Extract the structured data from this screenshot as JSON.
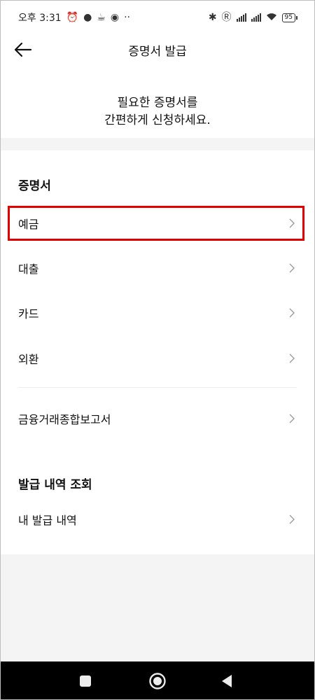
{
  "status_bar": {
    "time": "오후 3:31",
    "battery": "95",
    "icons": [
      "alarm-icon",
      "chat-icon",
      "coffee-icon",
      "chrome-icon",
      "more-dots-icon",
      "bluetooth-icon",
      "roaming-icon",
      "signal-icon",
      "signal-icon",
      "wifi-icon",
      "battery-icon"
    ]
  },
  "header": {
    "title": "증명서 발급"
  },
  "intro": {
    "line1": "필요한 증명서를",
    "line2": "간편하게 신청하세요."
  },
  "section_certificates": {
    "title": "증명서",
    "items": [
      {
        "label": "예금"
      },
      {
        "label": "대출"
      },
      {
        "label": "카드"
      },
      {
        "label": "외환"
      }
    ],
    "extra_item": {
      "label": "금융거래종합보고서"
    }
  },
  "section_history": {
    "title": "발급 내역 조회",
    "items": [
      {
        "label": "내 발급 내역"
      }
    ]
  },
  "colors": {
    "highlight": "#e10000",
    "band": "#f4f4f5",
    "navbar": "#000000"
  },
  "nav": {
    "icons": [
      "recent-apps-icon",
      "home-icon",
      "back-icon"
    ]
  }
}
